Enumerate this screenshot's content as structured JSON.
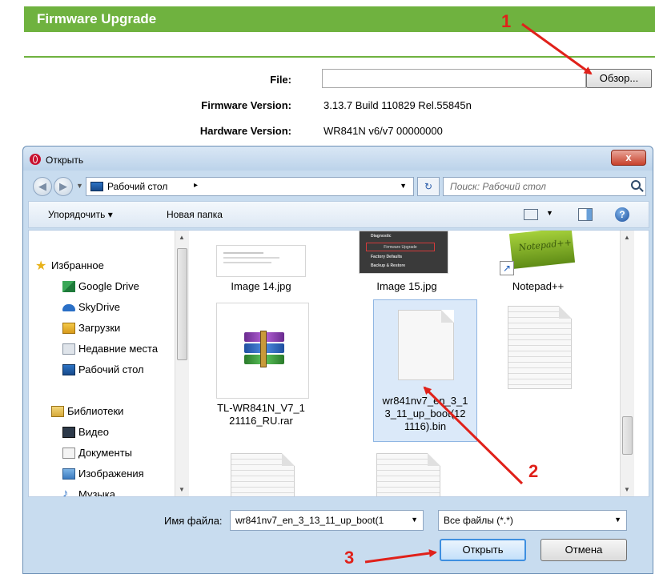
{
  "firmware_page": {
    "title": "Firmware Upgrade",
    "file_label": "File:",
    "browse_button": "Обзор...",
    "firmware_version_label": "Firmware Version:",
    "firmware_version_value": "3.13.7 Build 110829 Rel.55845n",
    "hardware_version_label": "Hardware Version:",
    "hardware_version_value": "WR841N v6/v7 00000000",
    "accent_color": "#6fb23f"
  },
  "dialog": {
    "title": "Открыть",
    "close_button": "x",
    "address": {
      "location": "Рабочий стол",
      "separator": "▸"
    },
    "search_placeholder": "Поиск: Рабочий стол",
    "toolbar": {
      "organize": "Упорядочить ▾",
      "new_folder": "Новая папка",
      "help": "?"
    },
    "nav": {
      "favorites": "Избранное",
      "items": [
        "Google Drive",
        "SkyDrive",
        "Загрузки",
        "Недавние места",
        "Рабочий стол"
      ],
      "libraries": "Библиотеки",
      "library_items": [
        "Видео",
        "Документы",
        "Изображения",
        "Музыка"
      ]
    },
    "files": [
      {
        "name": "Image 14.jpg",
        "icon": "image-thumbnail"
      },
      {
        "name": "Image 15.jpg",
        "icon": "image-thumbnail"
      },
      {
        "name": "Notepad++",
        "icon": "notepad-plus-plus-shortcut"
      },
      {
        "name": "TL-WR841N_V7_1\n21116_RU.rar",
        "icon": "winrar-archive"
      },
      {
        "name": "wr841nv7_en_3_1\n3_11_up_boot(12\n1116).bin",
        "icon": "blank-document",
        "selected": true
      },
      {
        "name": "",
        "icon": "text-document"
      },
      {
        "name": "",
        "icon": "text-document"
      },
      {
        "name": "",
        "icon": "text-document"
      }
    ],
    "thumbnail_text": {
      "image15_lines": [
        "Diagnostic",
        "Firmware Upgrade",
        "Factory Defaults",
        "Backup & Restore"
      ],
      "notepad_text": "Notepad++"
    },
    "filename_label": "Имя файла:",
    "filename_value": "wr841nv7_en_3_13_11_up_boot(1",
    "filetype_value": "Все файлы (*.*)",
    "open_button": "Открыть",
    "cancel_button": "Отмена"
  },
  "annotations": {
    "step1": "1",
    "step2": "2",
    "step3": "3",
    "color": "#e0211a"
  }
}
